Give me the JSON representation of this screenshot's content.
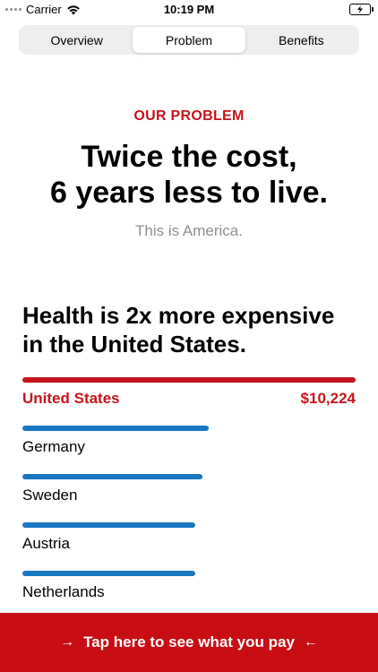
{
  "status_bar": {
    "carrier": "Carrier",
    "time": "10:19 PM"
  },
  "tabs": [
    {
      "label": "Overview",
      "active": false
    },
    {
      "label": "Problem",
      "active": true
    },
    {
      "label": "Benefits",
      "active": false
    }
  ],
  "hero": {
    "eyebrow": "OUR PROBLEM",
    "headline_line1": "Twice the cost,",
    "headline_line2": "6 years less to live.",
    "subtitle": "This is America."
  },
  "section": {
    "title_line1": "Health is 2x more expensive",
    "title_line2": "in the United States."
  },
  "countries": [
    {
      "name": "United States",
      "value_label": "$10,224",
      "fraction": 1.0,
      "highlight": true
    },
    {
      "name": "Germany",
      "value_label": "",
      "fraction": 0.56,
      "highlight": false
    },
    {
      "name": "Sweden",
      "value_label": "",
      "fraction": 0.54,
      "highlight": false
    },
    {
      "name": "Austria",
      "value_label": "",
      "fraction": 0.52,
      "highlight": false
    },
    {
      "name": "Netherlands",
      "value_label": "",
      "fraction": 0.52,
      "highlight": false
    }
  ],
  "cta": {
    "label": "Tap here to see what you pay",
    "arrow_left": "→",
    "arrow_right": "←"
  },
  "colors": {
    "accent_red": "#c5141b",
    "bar_blue": "#1a78c2",
    "cta_red": "#c80d14"
  }
}
